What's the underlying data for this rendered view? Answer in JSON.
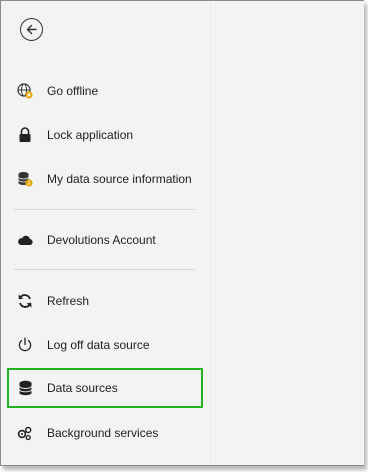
{
  "menu": {
    "back_icon": "arrow-left-circle-icon",
    "items": [
      {
        "label": "Go offline",
        "icon": "globe-offline-icon"
      },
      {
        "label": "Lock application",
        "icon": "lock-icon"
      },
      {
        "label": "My data source information",
        "icon": "database-info-icon"
      },
      {
        "label": "Devolutions Account",
        "icon": "cloud-icon"
      },
      {
        "label": "Refresh",
        "icon": "refresh-icon"
      },
      {
        "label": "Log off data source",
        "icon": "power-icon"
      },
      {
        "label": "Data sources",
        "icon": "database-stack-icon"
      },
      {
        "label": "Background services",
        "icon": "gears-icon"
      }
    ],
    "selected_index": 6
  },
  "colors": {
    "highlight": "#22b320",
    "panel_bg": "#f3f3f3"
  }
}
